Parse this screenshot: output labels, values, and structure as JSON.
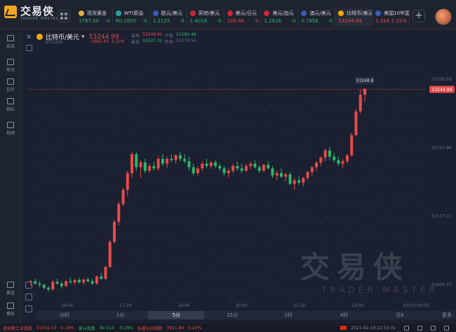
{
  "app": {
    "name_cn": "交易侠",
    "name_en": "TRADER MASTER"
  },
  "tickers": [
    {
      "name": "现货黄金",
      "price": "1787.50",
      "change": "-0",
      "icon_color": "#e0b040",
      "dir": "dn"
    },
    {
      "name": "WTI原油",
      "price": "60.1850",
      "change": "-0",
      "icon_color": "#2aa0a0",
      "dir": "dn"
    },
    {
      "name": "欧元/美元",
      "price": "1.2125",
      "change": "-0",
      "icon_color": "#3a5ab8",
      "dir": "dn"
    },
    {
      "name": "英镑/美元",
      "price": "1.4018",
      "change": "-0",
      "icon_color": "#c8283a",
      "dir": "dn"
    },
    {
      "name": "美元/日元",
      "price": "105.46",
      "change": "0",
      "icon_color": "#c8283a",
      "dir": "up"
    },
    {
      "name": "美元/加元",
      "price": "1.2616",
      "change": "-0",
      "icon_color": "#c8283a",
      "dir": "dn"
    },
    {
      "name": "澳元/美元",
      "price": "0.7856",
      "change": "-0",
      "icon_color": "#3a5ab8",
      "dir": "dn"
    },
    {
      "name": "比特币/美元",
      "price": "53244.99",
      "change": "",
      "icon_color": "#f2a900",
      "dir": "up"
    },
    {
      "name": "美国10年国债...",
      "price": "1.316",
      "change": "2.25%",
      "icon_color": "#3a5ab8",
      "dir": "up"
    }
  ],
  "sidebar": [
    {
      "label": "自选",
      "icon": "star-icon"
    },
    {
      "label": "快讯",
      "icon": "news-icon"
    },
    {
      "label": "日历",
      "icon": "calendar-icon"
    },
    {
      "label": "指标",
      "icon": "indicator-icon"
    },
    {
      "label": "视频",
      "icon": "video-icon"
    },
    {
      "label": "黄金",
      "icon": "gold-icon"
    },
    {
      "label": "模拟",
      "icon": "simulate-icon"
    }
  ],
  "symbol": {
    "name": "比特币/美元",
    "code": "BTCUSD",
    "price": "53244.99",
    "change": "1665.45",
    "change_pct": "3.23%",
    "stats": [
      {
        "label": "最高",
        "value": "53248.81",
        "label2": "开盘",
        "value2": "51580.48"
      },
      {
        "label": "最低",
        "value": "50527.32",
        "label2": "昨收",
        "value2": "51579.54"
      }
    ]
  },
  "timeframes": [
    "分时",
    "1分",
    "5分",
    "15分",
    "1时",
    "4时",
    "日K"
  ],
  "selected_timeframe": "5分",
  "more_label": "更多",
  "chart_data": {
    "type": "candlestick",
    "x_ticks": [
      "16:00",
      "17:20",
      "18:40",
      "20:00",
      "21:20",
      "22:40",
      "02/19 00:00"
    ],
    "y_ticks": [
      53330.59,
      52753.86,
      52177.11,
      51600.37
    ],
    "last_price_label": "53244.99",
    "high_label": "53248.8",
    "candles": [
      [
        51620,
        51640,
        51590,
        51630
      ],
      [
        51630,
        51650,
        51600,
        51610
      ],
      [
        51610,
        51630,
        51580,
        51600
      ],
      [
        51600,
        51610,
        51560,
        51575
      ],
      [
        51575,
        51590,
        51540,
        51560
      ],
      [
        51560,
        51640,
        51550,
        51625
      ],
      [
        51625,
        51650,
        51600,
        51610
      ],
      [
        51610,
        51630,
        51570,
        51590
      ],
      [
        51590,
        51640,
        51580,
        51630
      ],
      [
        51630,
        51660,
        51610,
        51620
      ],
      [
        51620,
        51650,
        51600,
        51640
      ],
      [
        51640,
        51660,
        51610,
        51620
      ],
      [
        51620,
        51650,
        51600,
        51645
      ],
      [
        51645,
        51660,
        51620,
        51630
      ],
      [
        51630,
        51650,
        51600,
        51610
      ],
      [
        51610,
        51680,
        51600,
        51670
      ],
      [
        51670,
        51700,
        51640,
        51650
      ],
      [
        51650,
        51760,
        51640,
        51750
      ],
      [
        51750,
        51980,
        51740,
        51960
      ],
      [
        51960,
        52150,
        51950,
        52130
      ],
      [
        52130,
        52300,
        52100,
        52280
      ],
      [
        52280,
        52420,
        52260,
        52400
      ],
      [
        52400,
        52560,
        52350,
        52540
      ],
      [
        52540,
        52720,
        52500,
        52700
      ],
      [
        52700,
        52720,
        52560,
        52590
      ],
      [
        52590,
        52650,
        52500,
        52630
      ],
      [
        52630,
        52660,
        52540,
        52560
      ],
      [
        52560,
        52620,
        52540,
        52600
      ],
      [
        52600,
        52640,
        52560,
        52580
      ],
      [
        52580,
        52680,
        52560,
        52660
      ],
      [
        52660,
        52700,
        52600,
        52620
      ],
      [
        52620,
        52680,
        52580,
        52660
      ],
      [
        52660,
        52700,
        52630,
        52650
      ],
      [
        52650,
        52700,
        52620,
        52690
      ],
      [
        52690,
        52720,
        52640,
        52660
      ],
      [
        52660,
        52700,
        52620,
        52640
      ],
      [
        52640,
        52680,
        52560,
        52590
      ],
      [
        52590,
        52620,
        52520,
        52540
      ],
      [
        52540,
        52600,
        52520,
        52580
      ],
      [
        52580,
        52640,
        52560,
        52620
      ],
      [
        52620,
        52660,
        52580,
        52600
      ],
      [
        52600,
        52640,
        52580,
        52630
      ],
      [
        52630,
        52650,
        52580,
        52600
      ],
      [
        52600,
        52620,
        52560,
        52580
      ],
      [
        52580,
        52600,
        52520,
        52540
      ],
      [
        52540,
        52580,
        52500,
        52560
      ],
      [
        52560,
        52620,
        52540,
        52600
      ],
      [
        52600,
        52640,
        52560,
        52580
      ],
      [
        52580,
        52620,
        52540,
        52560
      ],
      [
        52560,
        52620,
        52550,
        52600
      ],
      [
        52600,
        52640,
        52570,
        52620
      ],
      [
        52620,
        52650,
        52580,
        52590
      ],
      [
        52590,
        52610,
        52540,
        52560
      ],
      [
        52560,
        52620,
        52550,
        52610
      ],
      [
        52610,
        52640,
        52570,
        52580
      ],
      [
        52580,
        52600,
        52500,
        52520
      ],
      [
        52520,
        52560,
        52480,
        52540
      ],
      [
        52540,
        52580,
        52500,
        52510
      ],
      [
        52510,
        52540,
        52470,
        52530
      ],
      [
        52530,
        52550,
        52440,
        52450
      ],
      [
        52450,
        52500,
        52400,
        52480
      ],
      [
        52480,
        52520,
        52440,
        52460
      ],
      [
        52460,
        52510,
        52430,
        52500
      ],
      [
        52500,
        52560,
        52480,
        52550
      ],
      [
        52550,
        52600,
        52520,
        52590
      ],
      [
        52590,
        52640,
        52560,
        52630
      ],
      [
        52630,
        52680,
        52600,
        52670
      ],
      [
        52670,
        52750,
        52640,
        52730
      ],
      [
        52730,
        52760,
        52650,
        52680
      ],
      [
        52680,
        52710,
        52630,
        52650
      ],
      [
        52650,
        52680,
        52600,
        52620
      ],
      [
        52620,
        52660,
        52580,
        52640
      ],
      [
        52640,
        52700,
        52620,
        52690
      ],
      [
        52690,
        52880,
        52680,
        52860
      ],
      [
        52860,
        53080,
        52850,
        53060
      ],
      [
        53060,
        53248.8,
        53040,
        53200
      ],
      [
        53200,
        53250,
        53140,
        53244.99
      ]
    ]
  },
  "status_bar": [
    {
      "name": "道琼斯工业指数",
      "value": "31552.53",
      "pct": "0.19%",
      "dir": "up"
    },
    {
      "name": "美元指数",
      "value": "90.314",
      "pct": "-0.28%",
      "dir": "dn"
    },
    {
      "name": "标普500指数",
      "value": "3921.84",
      "pct": "0.20%",
      "dir": "up"
    }
  ],
  "datetime": "2021-02-19 22:53:31",
  "colors": {
    "up": "#e84a4a",
    "down": "#2fb56a",
    "bg": "#1b2030"
  }
}
